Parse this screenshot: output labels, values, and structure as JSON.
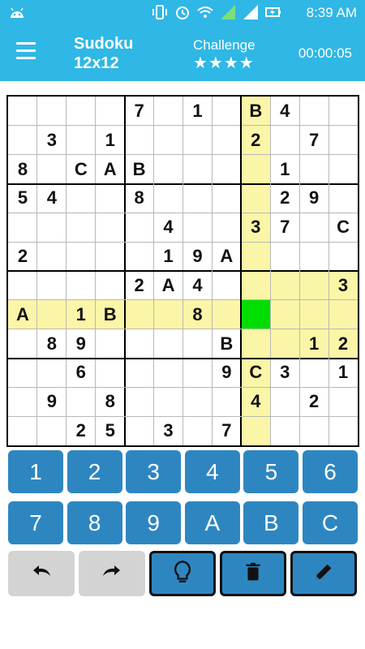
{
  "status": {
    "time": "8:39 AM"
  },
  "app": {
    "title_line1": "Sudoku",
    "title_line2": "12x12",
    "level": "Challenge",
    "stars": "★★★★",
    "timer": "00:00:05"
  },
  "board": {
    "size": 12,
    "box_rows": 3,
    "box_cols": 4,
    "selected": [
      7,
      8
    ],
    "highlight_color": "#fbf5a7",
    "selected_color": "#00dd00",
    "cells": [
      [
        "",
        "",
        "",
        "",
        "7",
        "",
        "1",
        "",
        "B",
        "4",
        "",
        ""
      ],
      [
        "",
        "3",
        "",
        "1",
        "",
        "",
        "",
        "",
        "2",
        "",
        "7",
        ""
      ],
      [
        "8",
        "",
        "C",
        "A",
        "B",
        "",
        "",
        "",
        "",
        "1",
        "",
        ""
      ],
      [
        "5",
        "4",
        "",
        "",
        "8",
        "",
        "",
        "",
        "",
        "2",
        "9",
        ""
      ],
      [
        "",
        "",
        "",
        "",
        "",
        "4",
        "",
        "",
        "3",
        "7",
        "",
        "C"
      ],
      [
        "2",
        "",
        "",
        "",
        "",
        "1",
        "9",
        "A",
        "",
        "",
        "",
        ""
      ],
      [
        "",
        "",
        "",
        "",
        "2",
        "A",
        "4",
        "",
        "",
        "",
        "",
        "3"
      ],
      [
        "A",
        "",
        "1",
        "B",
        "",
        "",
        "8",
        "",
        "",
        "",
        "",
        ""
      ],
      [
        "",
        "8",
        "9",
        "",
        "",
        "",
        "",
        "B",
        "",
        "",
        "1",
        "2"
      ],
      [
        "",
        "",
        "6",
        "",
        "",
        "",
        "",
        "9",
        "C",
        "3",
        "",
        "1"
      ],
      [
        "",
        "9",
        "",
        "8",
        "",
        "",
        "",
        "",
        "4",
        "",
        "2",
        ""
      ],
      [
        "",
        "",
        "2",
        "5",
        "",
        "3",
        "",
        "7",
        "",
        "",
        "",
        ""
      ]
    ]
  },
  "keypad": {
    "keys": [
      "1",
      "2",
      "3",
      "4",
      "5",
      "6",
      "7",
      "8",
      "9",
      "A",
      "B",
      "C"
    ],
    "key_color": "#2e86c1"
  },
  "tools": [
    {
      "name": "undo-button",
      "icon": "undo-icon"
    },
    {
      "name": "redo-button",
      "icon": "redo-icon"
    },
    {
      "name": "hint-button",
      "icon": "lightbulb-icon"
    },
    {
      "name": "erase-button",
      "icon": "trash-icon"
    },
    {
      "name": "pencil-button",
      "icon": "pencil-icon"
    }
  ]
}
